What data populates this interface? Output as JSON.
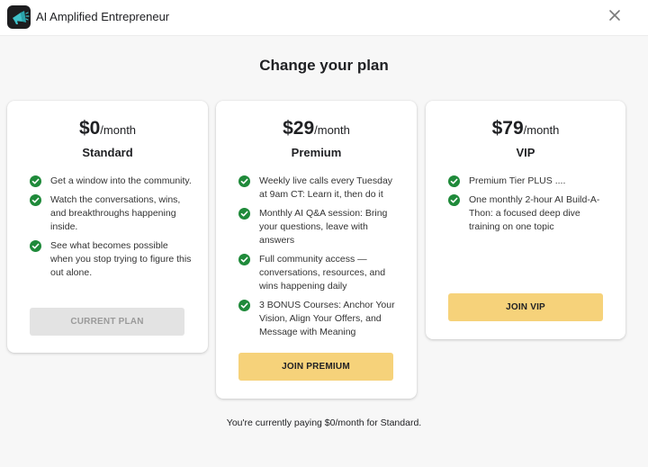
{
  "app": {
    "title": "AI Amplified Entrepreneur"
  },
  "page": {
    "heading": "Change your plan",
    "footer_note": "You're currently paying $0/month for Standard."
  },
  "icons": {
    "logo": "megaphone-logo-icon",
    "close": "close-icon",
    "feature_check": "check-circle-icon"
  },
  "colors": {
    "accent": "#f6d27a",
    "check": "#1f8a3a",
    "disabled_button": "#e3e3e3"
  },
  "plans": {
    "standard": {
      "amount": "$0",
      "period": "/month",
      "name": "Standard",
      "features": [
        "Get a window into the community.",
        "Watch the conversations, wins, and breakthroughs happening inside.",
        "See what becomes possible when you stop trying to figure this out alone."
      ],
      "button": "CURRENT PLAN"
    },
    "premium": {
      "amount": "$29",
      "period": "/month",
      "name": "Premium",
      "features": [
        "Weekly live calls every Tuesday at 9am CT: Learn it, then do it",
        "Monthly AI Q&A session: Bring your questions, leave with answers",
        "Full community access — conversations, resources, and wins happening daily",
        "3 BONUS Courses: Anchor Your Vision, Align Your Offers, and Message with Meaning"
      ],
      "button": "JOIN PREMIUM"
    },
    "vip": {
      "amount": "$79",
      "period": "/month",
      "name": "VIP",
      "features": [
        "Premium Tier PLUS ....",
        "One monthly 2-hour AI Build-A-Thon: a focused deep dive training on one topic"
      ],
      "button": "JOIN VIP"
    }
  }
}
